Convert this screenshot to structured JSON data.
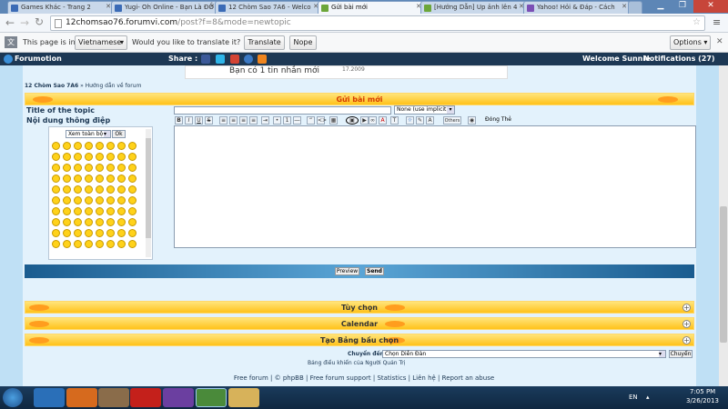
{
  "tabs": [
    {
      "title": "Games Khác - Trang 2",
      "color": "#3b6bb6"
    },
    {
      "title": "Yugi- Oh Online - Bạn Là ĐỒ",
      "color": "#3b6bb6"
    },
    {
      "title": "12 Chòm Sao 7A6 - Welco",
      "color": "#3b6bb6"
    },
    {
      "title": "Gửi bài mới",
      "color": "#6ca63a",
      "active": true
    },
    {
      "title": "[Hướng Dẫn] Up ảnh lên 4",
      "color": "#6ca63a"
    },
    {
      "title": "Yahoo! Hỏi & Đáp - Cách",
      "color": "#7b4fb5"
    }
  ],
  "address": {
    "host": "12chomsao76.forumvi.com",
    "path": "/post?f=8&mode=newtopic"
  },
  "translate_bar": {
    "prefix": "This page is in",
    "language": "Vietnamese",
    "question": "Would you like to translate it?",
    "translate_btn": "Translate",
    "nope_btn": "Nope",
    "options_btn": "Options"
  },
  "forumotion_bar": {
    "brand": "Forumotion",
    "share_label": "Share :",
    "welcome": "Welcome Sunnie",
    "notifications": "Notifications (27)"
  },
  "notice": {
    "text": "Bạn có 1 tin nhắn mới",
    "date": "17.2009"
  },
  "breadcrumb": {
    "forum": "12 Chòm Sao 7A6",
    "sep": "»",
    "section": "Hướng dẫn về forum"
  },
  "post_form": {
    "header": "Gửi bài mới",
    "title_label": "Title of the topic",
    "content_label": "Nội dung thông điệp",
    "title_value": "",
    "icon_select": "None (use implicit)",
    "emoticon_select": "Xem toàn bộ",
    "ok_btn": "Ok",
    "others_btn": "Others",
    "close_tags": "Đóng Thẻ",
    "preview_btn": "Preview",
    "send_btn": "Send"
  },
  "sections": [
    {
      "label": "Tùy chọn"
    },
    {
      "label": "Calendar"
    },
    {
      "label": "Tạo Bảng bầu chọn"
    }
  ],
  "jump": {
    "label": "Chuyển đến:",
    "select": "Chọn Diễn Đàn",
    "button": "Chuyển"
  },
  "admin_link": "Bảng điều khiển của Người Quản Trị",
  "footer": {
    "links": [
      "Free forum",
      "© phpBB",
      "Free forum support",
      "Statistics",
      "Liên hệ",
      "Report an abuse"
    ]
  },
  "taskbar": {
    "lang": "EN",
    "time": "7:05 PM",
    "date": "3/26/2013"
  },
  "colors": {
    "accent_orange": "#ff9d1e",
    "bar_yellow": "#ffc21a",
    "page_blue": "#bfe0f5",
    "fm_bar": "#1d3854"
  }
}
